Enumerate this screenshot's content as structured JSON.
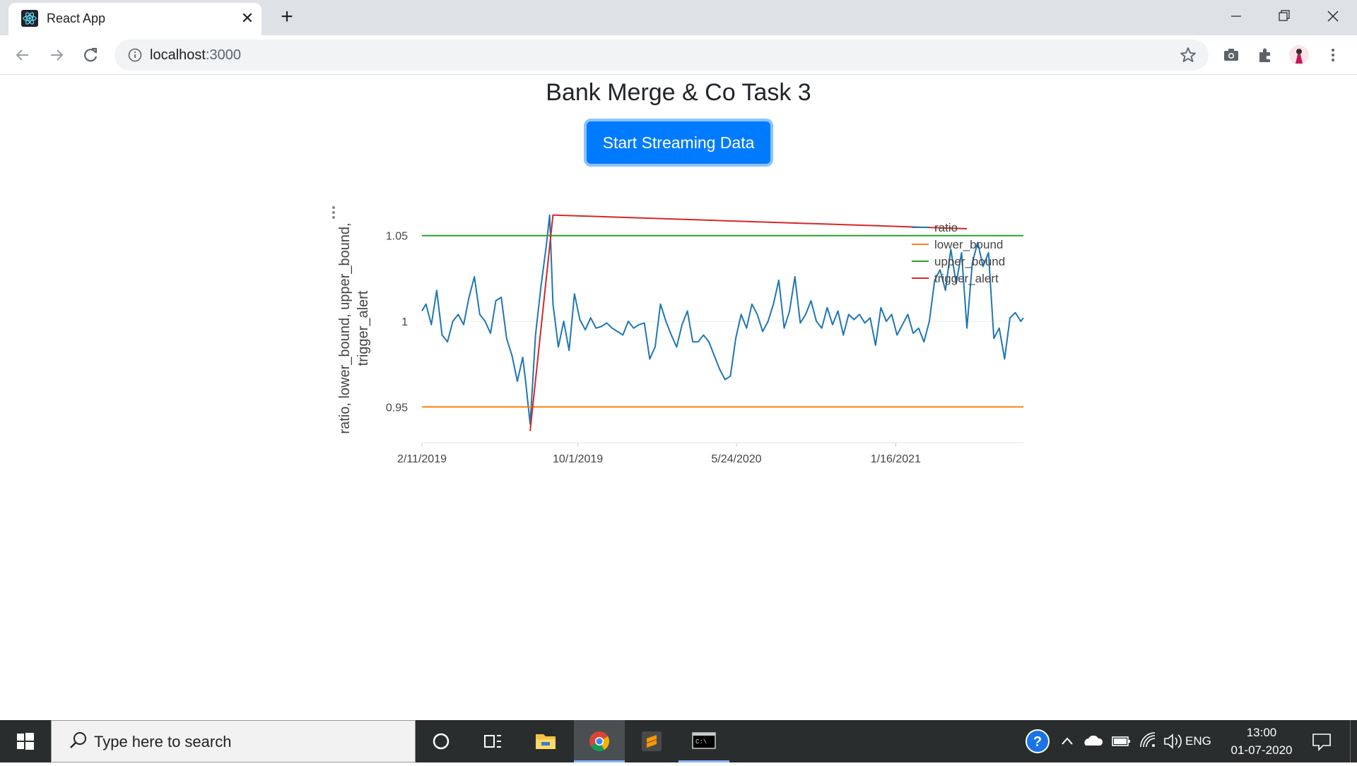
{
  "browser": {
    "tab_title": "React App",
    "url_host": "localhost",
    "url_port": ":3000"
  },
  "page": {
    "title": "Bank Merge & Co Task 3",
    "button_label": "Start Streaming Data"
  },
  "chart_data": {
    "type": "line",
    "title": "",
    "xlabel": "",
    "ylabel": "ratio, lower_bound, upper_bound, trigger_alert",
    "ylabel_lines": [
      "ratio, lower_bound, upper_bound,",
      "trigger_alert"
    ],
    "x_tick_labels": [
      "2/11/2019",
      "10/1/2019",
      "5/24/2020",
      "1/16/2021"
    ],
    "xlim": [
      "2019-02-11",
      "2021-07-25"
    ],
    "y_tick_labels": [
      "1.05",
      "1",
      "0.95"
    ],
    "ylim": [
      0.93,
      1.068
    ],
    "grid": "horizontal",
    "legend_position": "top-right",
    "series": [
      {
        "name": "ratio",
        "color": "#1f77b4",
        "x": [
          "2019-02-11",
          "2019-02-17",
          "2019-02-25",
          "2019-03-05",
          "2019-03-13",
          "2019-03-21",
          "2019-03-29",
          "2019-04-06",
          "2019-04-14",
          "2019-04-22",
          "2019-04-30",
          "2019-05-08",
          "2019-05-16",
          "2019-05-24",
          "2019-06-01",
          "2019-06-09",
          "2019-06-17",
          "2019-06-25",
          "2019-07-03",
          "2019-07-11",
          "2019-07-15",
          "2019-07-22",
          "2019-07-30",
          "2019-08-07",
          "2019-08-15",
          "2019-08-20",
          "2019-08-25",
          "2019-09-02",
          "2019-09-10",
          "2019-09-18",
          "2019-09-26",
          "2019-10-04",
          "2019-10-12",
          "2019-10-20",
          "2019-10-28",
          "2019-11-05",
          "2019-11-13",
          "2019-11-21",
          "2019-11-29",
          "2019-12-07",
          "2019-12-15",
          "2019-12-23",
          "2019-12-31",
          "2020-01-08",
          "2020-01-16",
          "2020-01-24",
          "2020-02-01",
          "2020-02-09",
          "2020-02-17",
          "2020-02-25",
          "2020-03-04",
          "2020-03-12",
          "2020-03-20",
          "2020-03-28",
          "2020-04-05",
          "2020-04-13",
          "2020-04-21",
          "2020-04-29",
          "2020-05-07",
          "2020-05-15",
          "2020-05-23",
          "2020-05-31",
          "2020-06-08",
          "2020-06-16",
          "2020-06-24",
          "2020-07-02",
          "2020-07-10",
          "2020-07-18",
          "2020-07-26",
          "2020-08-03",
          "2020-08-11",
          "2020-08-19",
          "2020-08-27",
          "2020-09-04",
          "2020-09-12",
          "2020-09-20",
          "2020-09-28",
          "2020-10-06",
          "2020-10-14",
          "2020-10-22",
          "2020-10-30",
          "2020-11-07",
          "2020-11-15",
          "2020-11-23",
          "2020-12-01",
          "2020-12-09",
          "2020-12-17",
          "2020-12-25",
          "2021-01-02",
          "2021-01-10",
          "2021-01-18",
          "2021-01-26",
          "2021-02-03",
          "2021-02-11",
          "2021-02-19",
          "2021-02-27",
          "2021-03-07",
          "2021-03-15",
          "2021-03-23",
          "2021-03-31",
          "2021-04-08",
          "2021-04-16",
          "2021-04-24",
          "2021-05-02",
          "2021-05-10",
          "2021-05-18",
          "2021-05-26",
          "2021-06-03",
          "2021-06-11",
          "2021-06-19",
          "2021-06-27",
          "2021-07-05",
          "2021-07-13",
          "2021-07-21",
          "2021-07-25"
        ],
        "values": [
          1.006,
          1.01,
          0.998,
          1.018,
          0.992,
          0.988,
          1.0,
          1.004,
          0.998,
          1.014,
          1.026,
          1.004,
          1.0,
          0.993,
          1.012,
          1.014,
          0.99,
          0.98,
          0.965,
          0.979,
          0.966,
          0.94,
          0.992,
          1.02,
          1.044,
          1.062,
          1.01,
          0.985,
          1.0,
          0.983,
          1.016,
          1.001,
          0.995,
          1.002,
          0.996,
          0.997,
          0.999,
          0.996,
          0.994,
          0.992,
          1.0,
          0.996,
          0.998,
          0.999,
          0.978,
          0.985,
          1.01,
          1.0,
          0.992,
          0.985,
          0.998,
          1.006,
          0.988,
          0.988,
          0.992,
          0.988,
          0.98,
          0.972,
          0.966,
          0.968,
          0.99,
          1.004,
          0.996,
          1.01,
          1.004,
          0.994,
          1.0,
          1.01,
          1.024,
          0.996,
          1.006,
          1.026,
          0.999,
          1.004,
          1.012,
          1.0,
          0.996,
          1.008,
          0.998,
          1.006,
          0.992,
          1.004,
          1.001,
          1.004,
          0.999,
          1.002,
          0.986,
          1.008,
          1.0,
          1.004,
          0.992,
          0.998,
          1.004,
          0.993,
          0.996,
          0.988,
          1.0,
          1.024,
          1.03,
          1.018,
          1.042,
          1.022,
          1.04,
          0.996,
          1.034,
          1.046,
          1.032,
          1.04,
          0.99,
          0.996,
          0.978,
          1.002,
          1.005,
          1.0,
          1.002
        ],
        "notes": ""
      },
      {
        "name": "lower_bound",
        "color": "#ff7f0e",
        "x": [
          "2019-02-11",
          "2021-07-25"
        ],
        "values": [
          0.95,
          0.95
        ]
      },
      {
        "name": "upper_bound",
        "color": "#2ca02c",
        "x": [
          "2019-02-11",
          "2021-07-25"
        ],
        "values": [
          1.05,
          1.05
        ]
      },
      {
        "name": "trigger_alert",
        "color": "#d62728",
        "x": [
          "2019-07-22",
          "2019-08-25",
          "2021-05-02"
        ],
        "values": [
          0.936,
          1.062,
          1.054
        ]
      }
    ]
  },
  "taskbar": {
    "search_placeholder": "Type here to search",
    "lang": "ENG",
    "time": "13:00",
    "date": "01-07-2020"
  }
}
